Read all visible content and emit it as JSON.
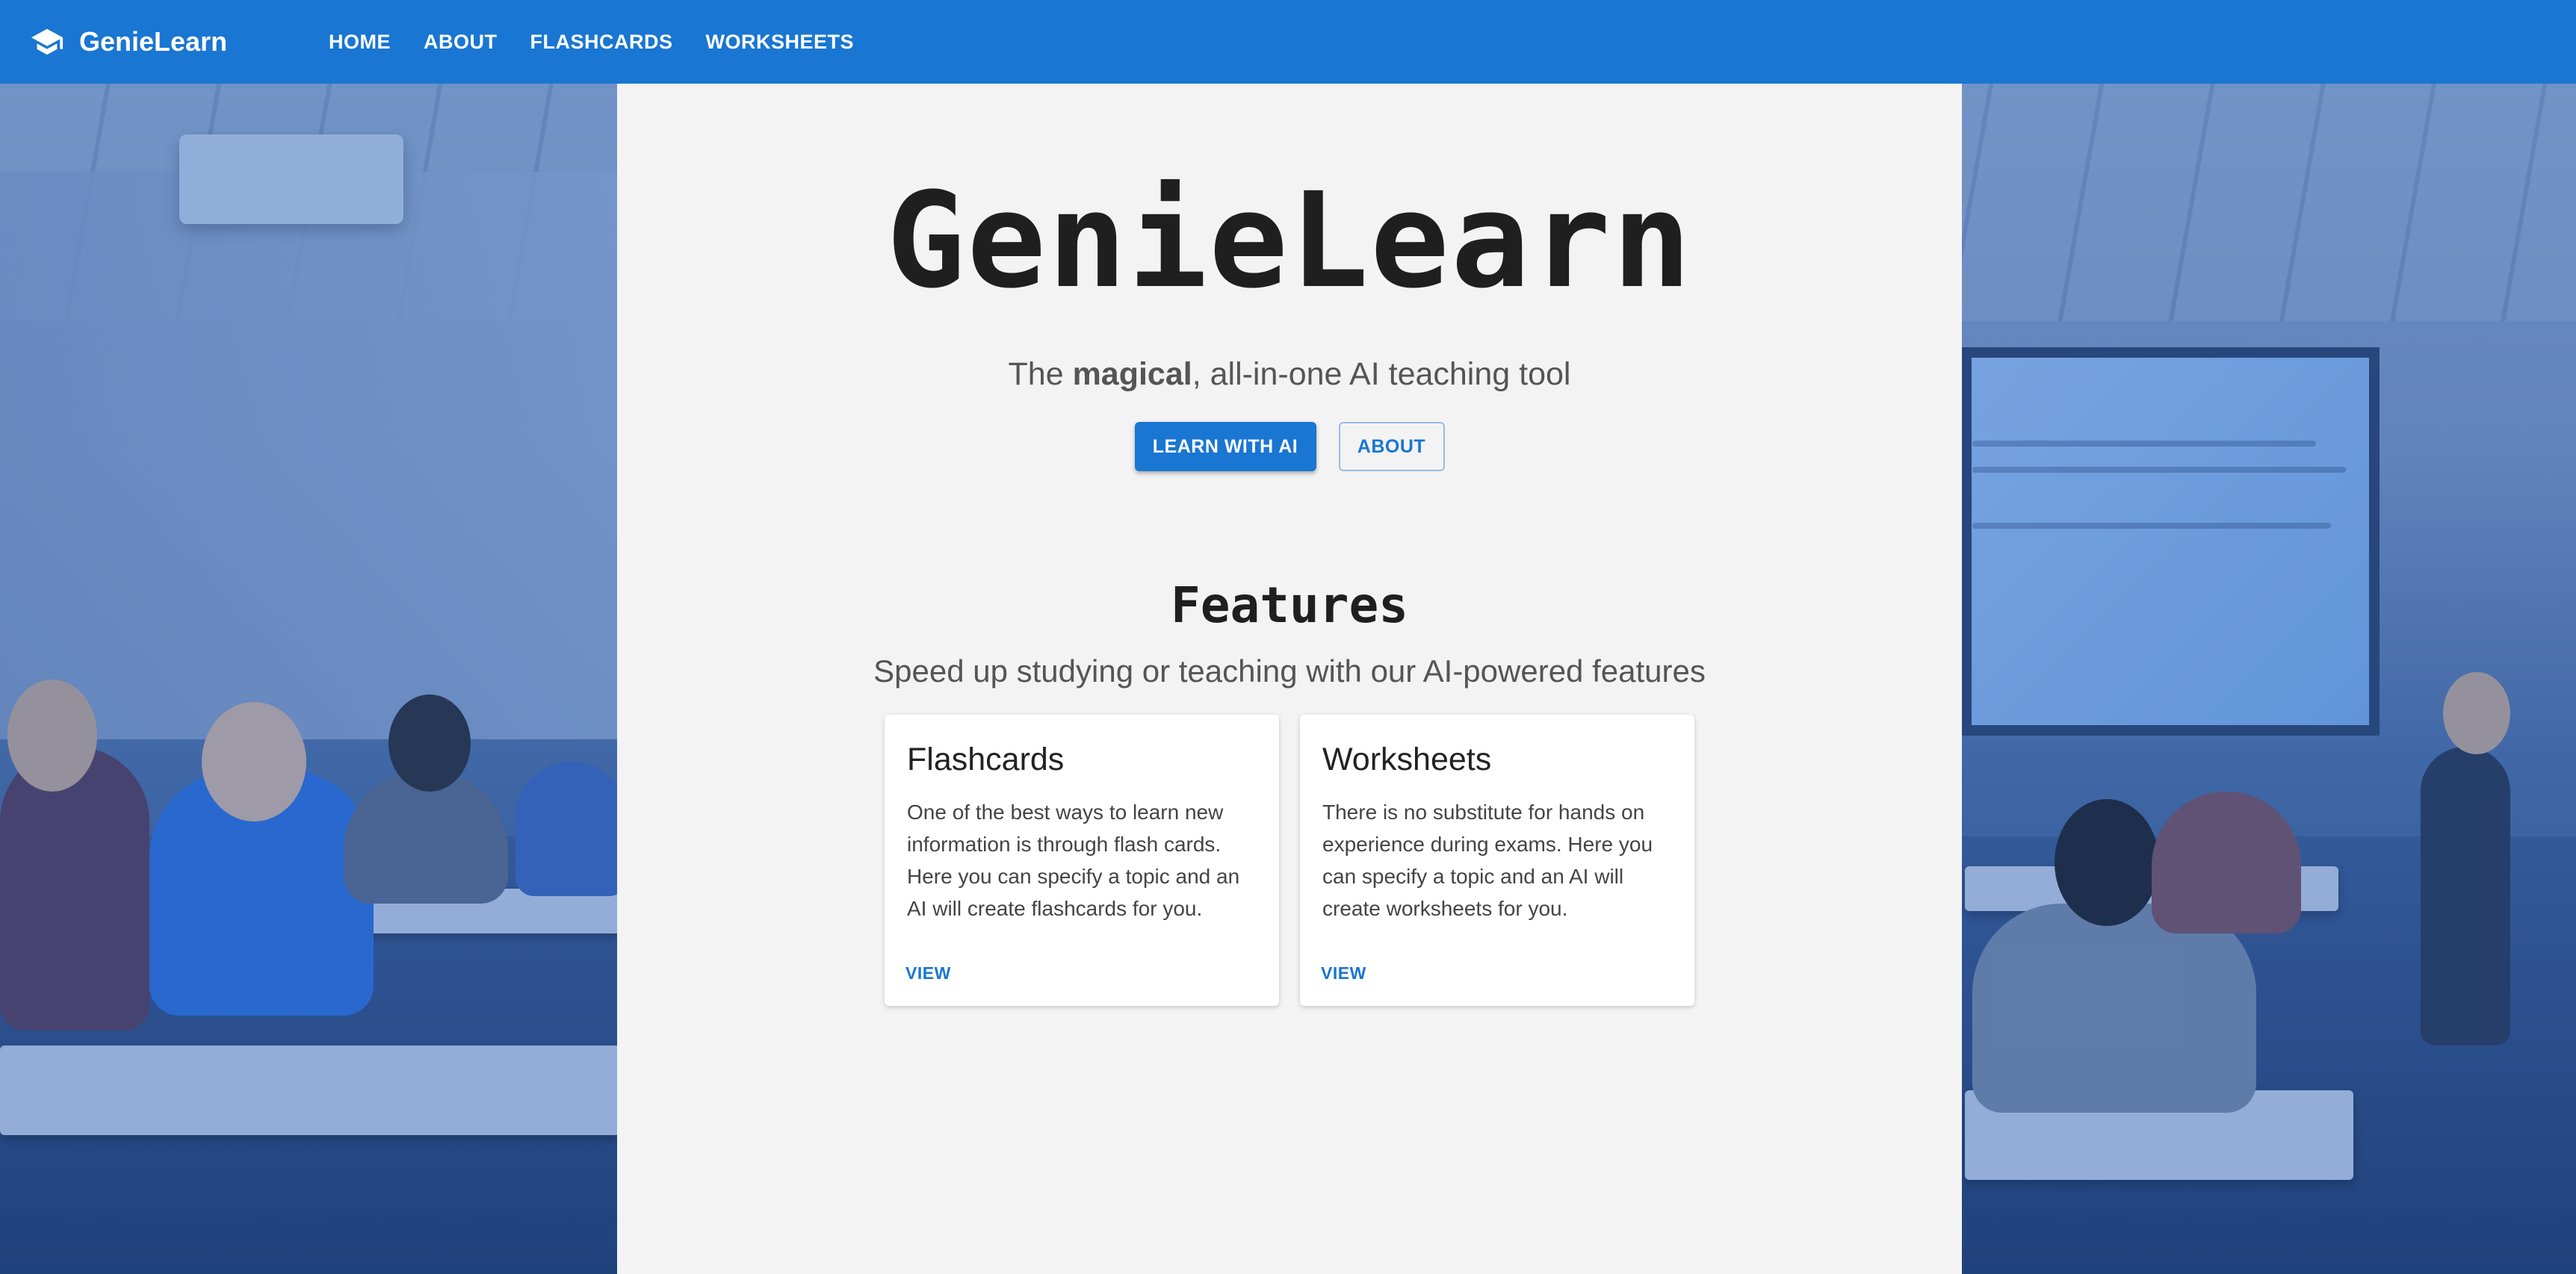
{
  "header": {
    "brand": "GenieLearn",
    "nav": [
      "HOME",
      "ABOUT",
      "FLASHCARDS",
      "WORKSHEETS"
    ]
  },
  "hero": {
    "title": "GenieLearn",
    "tagline_prefix": "The ",
    "tagline_emphasis": "magical",
    "tagline_suffix": ", all-in-one AI teaching tool",
    "primary_button": "LEARN WITH AI",
    "secondary_button": "ABOUT"
  },
  "features": {
    "title": "Features",
    "subtitle": "Speed up studying or teaching with our AI-powered features",
    "cards": [
      {
        "title": "Flashcards",
        "text": "One of the best ways to learn new information is through flash cards. Here you can specify a topic and an AI will create flashcards for you.",
        "link": "VIEW"
      },
      {
        "title": "Worksheets",
        "text": "There is no substitute for hands on experience during exams. Here you can specify a topic and an AI will create worksheets for you.",
        "link": "VIEW"
      }
    ]
  },
  "colors": {
    "primary": "#1976d2",
    "panel": "#f3f3f4",
    "background_tint": "#1e5abe"
  },
  "icons": {
    "brand": "graduation-cap-icon"
  }
}
